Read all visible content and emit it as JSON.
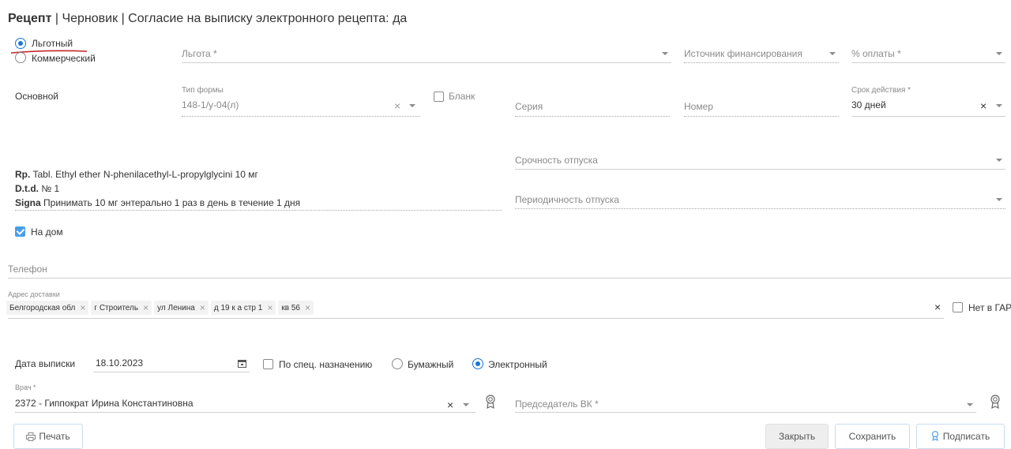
{
  "header": {
    "title": "Рецепт",
    "status": "Черновик",
    "consent": "Согласие на выписку электронного рецепта: да",
    "sep": "|"
  },
  "payment_type": {
    "options": [
      "Льготный",
      "Коммерческий"
    ],
    "selected": "Льготный"
  },
  "benefit": {
    "lgota_label": "Льгота *",
    "source_label": "Источник финансирования",
    "percent_label": "% оплаты *"
  },
  "form": {
    "section_label": "Основной",
    "type_label": "Тип формы",
    "type_value": "148-1/у-04(л)",
    "blank_label": "Бланк",
    "series_label": "Серия",
    "number_label": "Номер",
    "validity_label": "Срок действия *",
    "validity_value": "30 дней"
  },
  "prescription": {
    "rp_prefix": "Rp.",
    "rp_text": "Tabl. Ethyl ether N-phenilacethyl-L-propylglycini 10 мг",
    "dtd_prefix": "D.t.d.",
    "dtd_text": "№ 1",
    "signa_prefix": "Signa",
    "signa_text": "Принимать 10 мг энтерально 1 раз в день в течение 1 дня"
  },
  "urgency_label": "Срочность отпуска",
  "periodicity_label": "Периодичность отпуска",
  "home_label": "На дом",
  "phone_label": "Телефон",
  "address": {
    "label": "Адрес доставки",
    "chips": [
      "Белгородская обл",
      "г Строитель",
      "ул Ленина",
      "д 19 к а стр 1",
      "кв 56"
    ],
    "not_in_gar": "Нет в ГАР"
  },
  "issue": {
    "date_label": "Дата выписки",
    "date_value": "18.10.2023",
    "special_label": "По спец. назначению",
    "paper_label": "Бумажный",
    "electronic_label": "Электронный",
    "selected": "Электронный"
  },
  "doctor": {
    "label": "Врач *",
    "code": "2372",
    "name": "Гиппократ Ирина Константиновна",
    "chairman_label": "Председатель ВК *"
  },
  "buttons": {
    "print": "Печать",
    "close": "Закрыть",
    "save": "Сохранить",
    "sign": "Подписать"
  },
  "colors": {
    "accent": "#1976d2",
    "annotation": "#c62828",
    "checkbox": "#4a9ee8"
  }
}
